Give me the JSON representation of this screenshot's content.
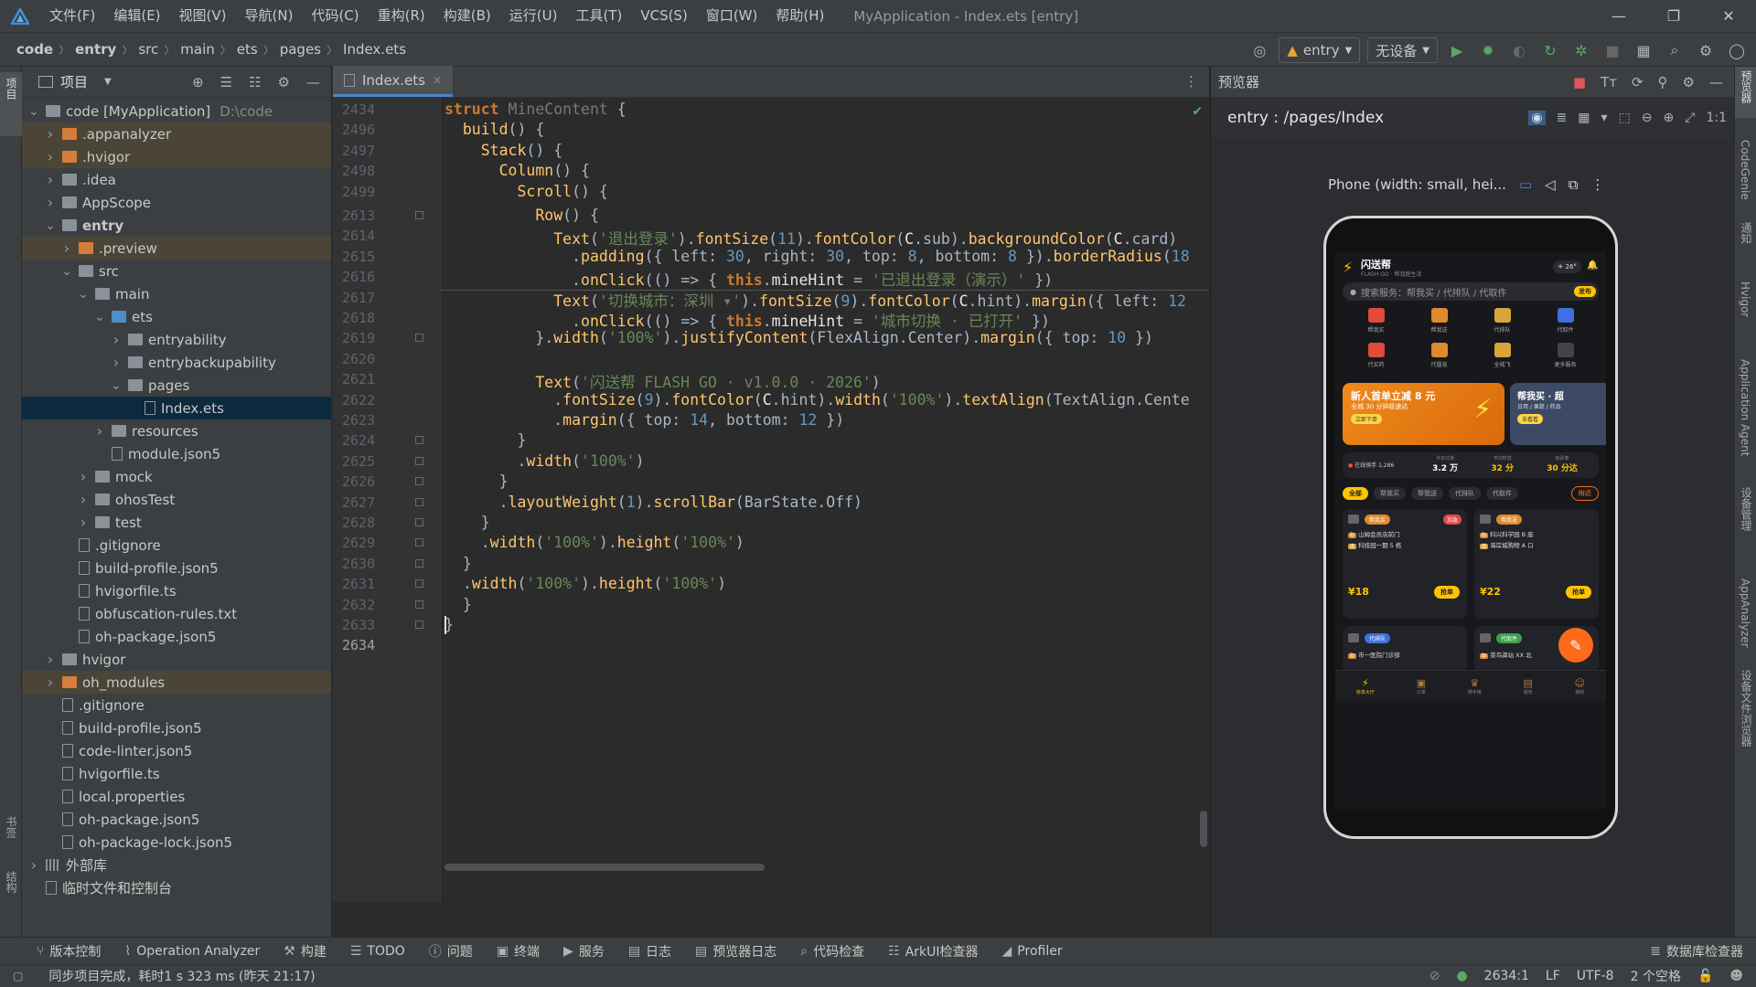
{
  "titlebar": {
    "menu": [
      "文件(F)",
      "编辑(E)",
      "视图(V)",
      "导航(N)",
      "代码(C)",
      "重构(R)",
      "构建(B)",
      "运行(U)",
      "工具(T)",
      "VCS(S)",
      "窗口(W)",
      "帮助(H)"
    ],
    "window_title": "MyApplication - Index.ets [entry]"
  },
  "breadcrumbs": [
    "code",
    "entry",
    "src",
    "main",
    "ets",
    "pages",
    "Index.ets"
  ],
  "run": {
    "module": "entry",
    "device": "无设备"
  },
  "project": {
    "title": "项目",
    "tree": [
      {
        "label": "code [MyApplication]",
        "extra": "D:\\code",
        "depth": 0,
        "arrow": "open",
        "kind": "proj"
      },
      {
        "label": ".appanalyzer",
        "depth": 1,
        "arrow": "closed",
        "kind": "orange",
        "hl": true
      },
      {
        "label": ".hvigor",
        "depth": 1,
        "arrow": "closed",
        "kind": "orange",
        "hl": true
      },
      {
        "label": ".idea",
        "depth": 1,
        "arrow": "closed",
        "kind": "gray"
      },
      {
        "label": "AppScope",
        "depth": 1,
        "arrow": "closed",
        "kind": "gray"
      },
      {
        "label": "entry",
        "depth": 1,
        "arrow": "open",
        "kind": "mod",
        "bold": true
      },
      {
        "label": ".preview",
        "depth": 2,
        "arrow": "closed",
        "kind": "orange",
        "hl": true
      },
      {
        "label": "src",
        "depth": 2,
        "arrow": "open",
        "kind": "gray"
      },
      {
        "label": "main",
        "depth": 3,
        "arrow": "open",
        "kind": "gray"
      },
      {
        "label": "ets",
        "depth": 4,
        "arrow": "open",
        "kind": "blue"
      },
      {
        "label": "entryability",
        "depth": 5,
        "arrow": "closed",
        "kind": "gray"
      },
      {
        "label": "entrybackupability",
        "depth": 5,
        "arrow": "closed",
        "kind": "gray"
      },
      {
        "label": "pages",
        "depth": 5,
        "arrow": "open",
        "kind": "gray"
      },
      {
        "label": "Index.ets",
        "depth": 6,
        "arrow": "none",
        "kind": "file",
        "sel": true
      },
      {
        "label": "resources",
        "depth": 4,
        "arrow": "closed",
        "kind": "gray"
      },
      {
        "label": "module.json5",
        "depth": 4,
        "arrow": "none",
        "kind": "file"
      },
      {
        "label": "mock",
        "depth": 3,
        "arrow": "closed",
        "kind": "gray"
      },
      {
        "label": "ohosTest",
        "depth": 3,
        "arrow": "closed",
        "kind": "gray"
      },
      {
        "label": "test",
        "depth": 3,
        "arrow": "closed",
        "kind": "gray"
      },
      {
        "label": ".gitignore",
        "depth": 2,
        "arrow": "none",
        "kind": "file"
      },
      {
        "label": "build-profile.json5",
        "depth": 2,
        "arrow": "none",
        "kind": "file"
      },
      {
        "label": "hvigorfile.ts",
        "depth": 2,
        "arrow": "none",
        "kind": "file"
      },
      {
        "label": "obfuscation-rules.txt",
        "depth": 2,
        "arrow": "none",
        "kind": "file"
      },
      {
        "label": "oh-package.json5",
        "depth": 2,
        "arrow": "none",
        "kind": "file"
      },
      {
        "label": "hvigor",
        "depth": 1,
        "arrow": "closed",
        "kind": "gray"
      },
      {
        "label": "oh_modules",
        "depth": 1,
        "arrow": "closed",
        "kind": "orange",
        "hl": true
      },
      {
        "label": ".gitignore",
        "depth": 1,
        "arrow": "none",
        "kind": "file"
      },
      {
        "label": "build-profile.json5",
        "depth": 1,
        "arrow": "none",
        "kind": "file"
      },
      {
        "label": "code-linter.json5",
        "depth": 1,
        "arrow": "none",
        "kind": "file"
      },
      {
        "label": "hvigorfile.ts",
        "depth": 1,
        "arrow": "none",
        "kind": "file"
      },
      {
        "label": "local.properties",
        "depth": 1,
        "arrow": "none",
        "kind": "file"
      },
      {
        "label": "oh-package.json5",
        "depth": 1,
        "arrow": "none",
        "kind": "file"
      },
      {
        "label": "oh-package-lock.json5",
        "depth": 1,
        "arrow": "none",
        "kind": "file"
      },
      {
        "label": "外部库",
        "depth": 0,
        "arrow": "closed",
        "kind": "lib"
      },
      {
        "label": "临时文件和控制台",
        "depth": 0,
        "arrow": "none",
        "kind": "scratch"
      }
    ]
  },
  "editor": {
    "tab": "Index.ets",
    "lines": [
      {
        "n": "2434",
        "html": "<span class='kw'>struct</span> <span class='gray'>MineContent</span> {"
      },
      {
        "n": "2496",
        "html": "  <span class='fn'>build</span>() {"
      },
      {
        "n": "2497",
        "html": "    <span class='fn'>Stack</span>() {"
      },
      {
        "n": "2498",
        "html": "      <span class='fn'>Column</span>() {"
      },
      {
        "n": "2499",
        "html": "        <span class='fn'>Scroll</span>() {"
      },
      {
        "n": "2613",
        "html": "          <span class='fn'>Row</span>() {"
      },
      {
        "n": "2614",
        "html": "            <span class='fn'>Text</span>(<span class='str'>'退出登录'</span>).<span class='fn'>fontSize</span>(<span class='num'>11</span>).<span class='fn'>fontColor</span>(<span class='wh'>C</span>.sub).<span class='fn'>backgroundColor</span>(<span class='wh'>C</span>.card)"
      },
      {
        "n": "2615",
        "html": "              .<span class='fn'>padding</span>({ left: <span class='num'>30</span>, right: <span class='num'>30</span>, top: <span class='num'>8</span>, bottom: <span class='num'>8</span> }).<span class='fn'>borderRadius</span>(<span class='num'>18</span>"
      },
      {
        "n": "2616",
        "html": "              .<span class='fn'>onClick</span>(() => { <span class='kw'>this</span>.<span class='wh'>mineHint</span> = <span class='str'>'已退出登录（演示）'</span> })"
      },
      {
        "n": "2617",
        "html": "            <span class='fn'>Text</span>(<span class='str'>'切换城市：深圳 ▾'</span>).<span class='fn'>fontSize</span>(<span class='num'>9</span>).<span class='fn'>fontColor</span>(<span class='wh'>C</span>.hint).<span class='fn'>margin</span>({ left: <span class='num'>12</span>"
      },
      {
        "n": "2618",
        "html": "              .<span class='fn'>onClick</span>(() => { <span class='kw'>this</span>.<span class='wh'>mineHint</span> = <span class='str'>'城市切换 · 已打开'</span> })"
      },
      {
        "n": "2619",
        "html": "          }.<span class='fn'>width</span>(<span class='str'>'100%'</span>).<span class='fn'>justifyContent</span>(FlexAlign.Center).<span class='fn'>margin</span>({ top: <span class='num'>10</span> })"
      },
      {
        "n": "2620",
        "html": ""
      },
      {
        "n": "2621",
        "html": "          <span class='fn'>Text</span>(<span class='str'>'闪送帮 FLASH GO · v1.0.0 · 2026'</span>)"
      },
      {
        "n": "2622",
        "html": "            .<span class='fn'>fontSize</span>(<span class='num'>9</span>).<span class='fn'>fontColor</span>(<span class='wh'>C</span>.hint).<span class='fn'>width</span>(<span class='str'>'100%'</span>).<span class='fn'>textAlign</span>(TextAlign.Cente"
      },
      {
        "n": "2623",
        "html": "            .<span class='fn'>margin</span>({ top: <span class='num'>14</span>, bottom: <span class='num'>12</span> })"
      },
      {
        "n": "2624",
        "html": "        }"
      },
      {
        "n": "2625",
        "html": "        .<span class='fn'>width</span>(<span class='str'>'100%'</span>)"
      },
      {
        "n": "2626",
        "html": "      }"
      },
      {
        "n": "2627",
        "html": "      .<span class='fn'>layoutWeight</span>(<span class='num'>1</span>).<span class='fn'>scrollBar</span>(BarState.Off)"
      },
      {
        "n": "2628",
        "html": "    }"
      },
      {
        "n": "2629",
        "html": "    .<span class='fn'>width</span>(<span class='str'>'100%'</span>).<span class='fn'>height</span>(<span class='str'>'100%'</span>)"
      },
      {
        "n": "2630",
        "html": "  }"
      },
      {
        "n": "2631",
        "html": "  .<span class='fn'>width</span>(<span class='str'>'100%'</span>).<span class='fn'>height</span>(<span class='str'>'100%'</span>)"
      },
      {
        "n": "2632",
        "html": "  }"
      },
      {
        "n": "2633",
        "html": "}"
      },
      {
        "n": "2634",
        "html": ""
      }
    ]
  },
  "preview": {
    "title": "预览器",
    "path": "entry : /pages/Index",
    "device": "Phone (width: small, hei...",
    "app": {
      "name": "闪送帮",
      "sub": "FLASH GO · 帮我跑生活",
      "temp": "26°",
      "search": "搜索服务：帮我买 / 代排队 / 代取件",
      "publish": "发布",
      "grid1": [
        "帮我买",
        "帮我送",
        "代排队",
        "代取件"
      ],
      "grid2": [
        "代买药",
        "代遛宠",
        "全城飞",
        "更多服务"
      ],
      "promo_title": "新人首单立减 8 元",
      "promo_sub": "全城 30 分钟极速达",
      "promo_btn": "立即下单",
      "promo2_title": "帮我买 · 超",
      "promo2_sub": "日用 / 果蔬 / 药品",
      "promo2_btn": "去看看",
      "stats_live": "在线骑手 1,286",
      "stats": [
        {
          "k": "今日订单",
          "v": "3.2 万"
        },
        {
          "k": "平均时效",
          "v": "32 分"
        },
        {
          "k": "好评率",
          "v": "30 分达"
        }
      ],
      "filters": [
        "全部",
        "帮我买",
        "帮我送",
        "代排队",
        "代取件"
      ],
      "filter_hot": "附近",
      "orders": [
        {
          "tag": "帮我买",
          "badge": "加急",
          "from": "山姆会员店前门",
          "to": "科技园一期 5 栋",
          "price": "¥18",
          "btn": "抢单"
        },
        {
          "tag": "帮我送",
          "badge": "",
          "from": "科兴科学园 B 座",
          "to": "海岸城购物 A 口",
          "price": "¥22",
          "btn": "抢单"
        }
      ],
      "orders2": [
        {
          "tag": "代排队",
          "from": "市一医院门诊部"
        },
        {
          "tag": "代取件",
          "from": "菜鸟驿站 XX 北"
        }
      ],
      "tabbar": [
        "抢单大厅",
        "订单",
        "骑手榜",
        "钱包",
        "我的"
      ]
    }
  },
  "bottombar": [
    "版本控制",
    "Operation Analyzer",
    "构建",
    "TODO",
    "问题",
    "终端",
    "服务",
    "日志",
    "预览器日志",
    "代码检查",
    "ArkUI检查器",
    "Profiler",
    "数据库检查器"
  ],
  "status": {
    "message": "同步项目完成，耗时1 s 323 ms (昨天 21:17)",
    "cursor": "2634:1",
    "eol": "LF",
    "enc": "UTF-8",
    "indent": "2 个空格"
  },
  "right_stripe": [
    "预览器",
    "CodeGenie",
    "通知",
    "Hvigor",
    "Application Agent",
    "设备管理",
    "AppAnalyzer",
    "设备文件浏览器"
  ],
  "left_stripe": [
    "项目",
    "书签",
    "结构"
  ]
}
